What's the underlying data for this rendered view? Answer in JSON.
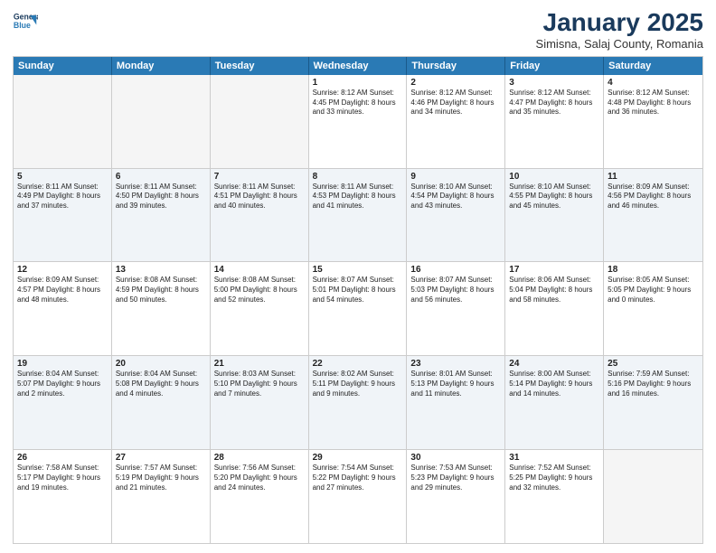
{
  "header": {
    "logo_line1": "General",
    "logo_line2": "Blue",
    "month_title": "January 2025",
    "subtitle": "Simisna, Salaj County, Romania"
  },
  "days_of_week": [
    "Sunday",
    "Monday",
    "Tuesday",
    "Wednesday",
    "Thursday",
    "Friday",
    "Saturday"
  ],
  "rows": [
    [
      {
        "day": "",
        "text": ""
      },
      {
        "day": "",
        "text": ""
      },
      {
        "day": "",
        "text": ""
      },
      {
        "day": "1",
        "text": "Sunrise: 8:12 AM\nSunset: 4:45 PM\nDaylight: 8 hours\nand 33 minutes."
      },
      {
        "day": "2",
        "text": "Sunrise: 8:12 AM\nSunset: 4:46 PM\nDaylight: 8 hours\nand 34 minutes."
      },
      {
        "day": "3",
        "text": "Sunrise: 8:12 AM\nSunset: 4:47 PM\nDaylight: 8 hours\nand 35 minutes."
      },
      {
        "day": "4",
        "text": "Sunrise: 8:12 AM\nSunset: 4:48 PM\nDaylight: 8 hours\nand 36 minutes."
      }
    ],
    [
      {
        "day": "5",
        "text": "Sunrise: 8:11 AM\nSunset: 4:49 PM\nDaylight: 8 hours\nand 37 minutes."
      },
      {
        "day": "6",
        "text": "Sunrise: 8:11 AM\nSunset: 4:50 PM\nDaylight: 8 hours\nand 39 minutes."
      },
      {
        "day": "7",
        "text": "Sunrise: 8:11 AM\nSunset: 4:51 PM\nDaylight: 8 hours\nand 40 minutes."
      },
      {
        "day": "8",
        "text": "Sunrise: 8:11 AM\nSunset: 4:53 PM\nDaylight: 8 hours\nand 41 minutes."
      },
      {
        "day": "9",
        "text": "Sunrise: 8:10 AM\nSunset: 4:54 PM\nDaylight: 8 hours\nand 43 minutes."
      },
      {
        "day": "10",
        "text": "Sunrise: 8:10 AM\nSunset: 4:55 PM\nDaylight: 8 hours\nand 45 minutes."
      },
      {
        "day": "11",
        "text": "Sunrise: 8:09 AM\nSunset: 4:56 PM\nDaylight: 8 hours\nand 46 minutes."
      }
    ],
    [
      {
        "day": "12",
        "text": "Sunrise: 8:09 AM\nSunset: 4:57 PM\nDaylight: 8 hours\nand 48 minutes."
      },
      {
        "day": "13",
        "text": "Sunrise: 8:08 AM\nSunset: 4:59 PM\nDaylight: 8 hours\nand 50 minutes."
      },
      {
        "day": "14",
        "text": "Sunrise: 8:08 AM\nSunset: 5:00 PM\nDaylight: 8 hours\nand 52 minutes."
      },
      {
        "day": "15",
        "text": "Sunrise: 8:07 AM\nSunset: 5:01 PM\nDaylight: 8 hours\nand 54 minutes."
      },
      {
        "day": "16",
        "text": "Sunrise: 8:07 AM\nSunset: 5:03 PM\nDaylight: 8 hours\nand 56 minutes."
      },
      {
        "day": "17",
        "text": "Sunrise: 8:06 AM\nSunset: 5:04 PM\nDaylight: 8 hours\nand 58 minutes."
      },
      {
        "day": "18",
        "text": "Sunrise: 8:05 AM\nSunset: 5:05 PM\nDaylight: 9 hours\nand 0 minutes."
      }
    ],
    [
      {
        "day": "19",
        "text": "Sunrise: 8:04 AM\nSunset: 5:07 PM\nDaylight: 9 hours\nand 2 minutes."
      },
      {
        "day": "20",
        "text": "Sunrise: 8:04 AM\nSunset: 5:08 PM\nDaylight: 9 hours\nand 4 minutes."
      },
      {
        "day": "21",
        "text": "Sunrise: 8:03 AM\nSunset: 5:10 PM\nDaylight: 9 hours\nand 7 minutes."
      },
      {
        "day": "22",
        "text": "Sunrise: 8:02 AM\nSunset: 5:11 PM\nDaylight: 9 hours\nand 9 minutes."
      },
      {
        "day": "23",
        "text": "Sunrise: 8:01 AM\nSunset: 5:13 PM\nDaylight: 9 hours\nand 11 minutes."
      },
      {
        "day": "24",
        "text": "Sunrise: 8:00 AM\nSunset: 5:14 PM\nDaylight: 9 hours\nand 14 minutes."
      },
      {
        "day": "25",
        "text": "Sunrise: 7:59 AM\nSunset: 5:16 PM\nDaylight: 9 hours\nand 16 minutes."
      }
    ],
    [
      {
        "day": "26",
        "text": "Sunrise: 7:58 AM\nSunset: 5:17 PM\nDaylight: 9 hours\nand 19 minutes."
      },
      {
        "day": "27",
        "text": "Sunrise: 7:57 AM\nSunset: 5:19 PM\nDaylight: 9 hours\nand 21 minutes."
      },
      {
        "day": "28",
        "text": "Sunrise: 7:56 AM\nSunset: 5:20 PM\nDaylight: 9 hours\nand 24 minutes."
      },
      {
        "day": "29",
        "text": "Sunrise: 7:54 AM\nSunset: 5:22 PM\nDaylight: 9 hours\nand 27 minutes."
      },
      {
        "day": "30",
        "text": "Sunrise: 7:53 AM\nSunset: 5:23 PM\nDaylight: 9 hours\nand 29 minutes."
      },
      {
        "day": "31",
        "text": "Sunrise: 7:52 AM\nSunset: 5:25 PM\nDaylight: 9 hours\nand 32 minutes."
      },
      {
        "day": "",
        "text": ""
      }
    ]
  ]
}
